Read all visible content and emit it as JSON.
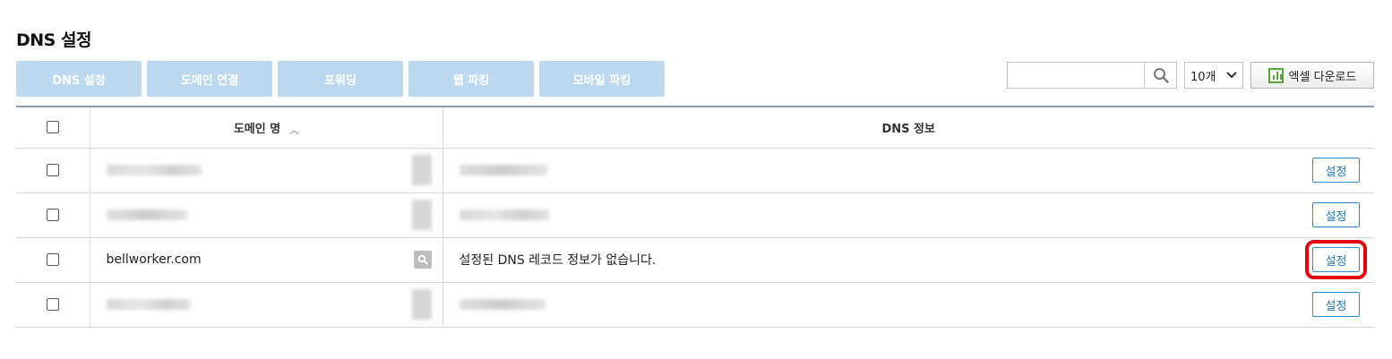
{
  "page": {
    "title": "DNS 설정"
  },
  "tabs": [
    {
      "label": "DNS 설정"
    },
    {
      "label": "도메인 연결"
    },
    {
      "label": "포워딩"
    },
    {
      "label": "웹 파킹"
    },
    {
      "label": "모바일 파킹"
    }
  ],
  "toolbar": {
    "search_value": "",
    "search_icon": "magnifier-icon",
    "page_size": "10개",
    "excel_label": "엑셀 다운로드",
    "excel_icon": "excel-chart-icon"
  },
  "table": {
    "headers": {
      "domain": "도메인 명",
      "dns_info": "DNS 정보"
    },
    "sort": "ascending",
    "rows": [
      {
        "domain": "",
        "dns_info": "",
        "redacted": true,
        "action": "설정"
      },
      {
        "domain": "",
        "dns_info": "",
        "redacted": true,
        "action": "설정"
      },
      {
        "domain": "bellworker.com",
        "dns_info": "설정된 DNS 레코드 정보가 없습니다.",
        "redacted": false,
        "action": "설정",
        "highlighted": true
      },
      {
        "domain": "",
        "dns_info": "",
        "redacted": true,
        "action": "설정"
      }
    ]
  },
  "colors": {
    "tab_bg": "#bcd9ef",
    "button_blue": "#1f79c0",
    "highlight": "#e4000f"
  }
}
